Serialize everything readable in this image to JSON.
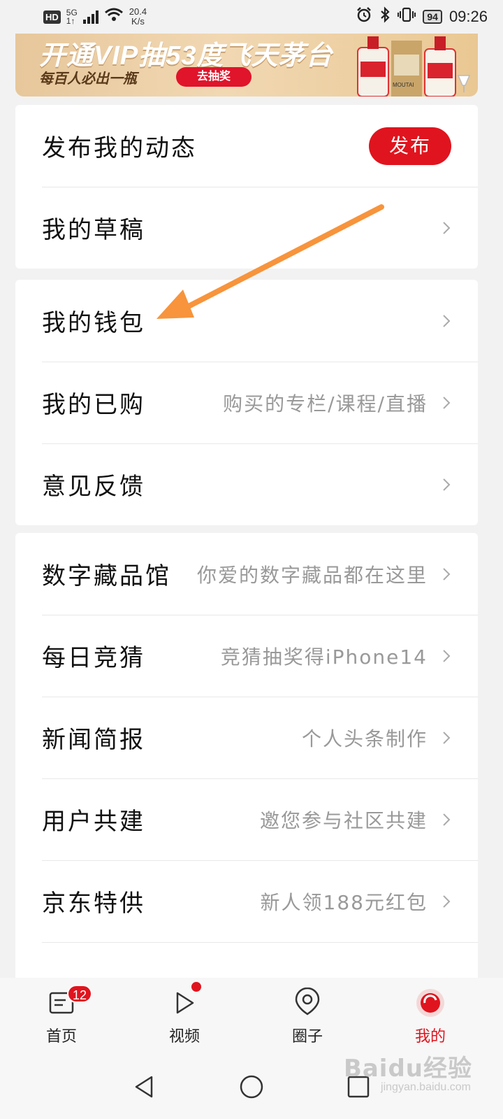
{
  "status_bar": {
    "hd": "HD",
    "network": "5G",
    "net_sub": "1↑",
    "speed_value": "20.4",
    "speed_unit": "K/s",
    "battery": "94",
    "time": "09:26"
  },
  "banner": {
    "title": "开通VIP抽53度飞天茅台",
    "subtitle": "每百人必出一瓶",
    "button": "去抽奖",
    "bottle_label": "MOUTAI"
  },
  "menu": {
    "group1": [
      {
        "title": "发布我的动态",
        "button": "发布"
      },
      {
        "title": "我的草稿"
      }
    ],
    "group2": [
      {
        "title": "我的钱包"
      },
      {
        "title": "我的已购",
        "sub": "购买的专栏/课程/直播"
      },
      {
        "title": "意见反馈"
      }
    ],
    "group3": [
      {
        "title": "数字藏品馆",
        "sub": "你爱的数字藏品都在这里"
      },
      {
        "title": "每日竞猜",
        "sub": "竞猜抽奖得iPhone14"
      },
      {
        "title": "新闻简报",
        "sub": "个人头条制作"
      },
      {
        "title": "用户共建",
        "sub": "邀您参与社区共建"
      },
      {
        "title": "京东特供",
        "sub": "新人领188元红包"
      }
    ]
  },
  "bottom_nav": [
    {
      "label": "首页",
      "badge": "12"
    },
    {
      "label": "视频"
    },
    {
      "label": "圈子"
    },
    {
      "label": "我的"
    }
  ],
  "colors": {
    "accent": "#e0141e",
    "annotation_arrow": "#f7943c"
  },
  "watermark": {
    "text": "Baidu经验",
    "sub": "jingyan.baidu.com"
  }
}
